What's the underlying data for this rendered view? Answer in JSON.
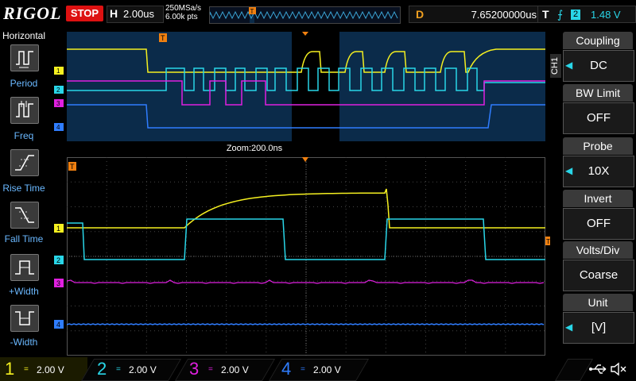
{
  "brand": "RIGOL",
  "run_state": "STOP",
  "horizontal": {
    "label": "H",
    "timebase": "2.00us",
    "sample_rate": "250MSa/s",
    "memory_depth": "6.00k pts"
  },
  "delay": {
    "label": "D",
    "value": "7.65200000us"
  },
  "trigger": {
    "label": "T",
    "source": "2",
    "level": "1.48 V",
    "marker": "T"
  },
  "sidebar": {
    "title": "Horizontal",
    "items": [
      {
        "label": "Period"
      },
      {
        "label": "Freq"
      },
      {
        "label": "Rise Time"
      },
      {
        "label": "Fall Time"
      },
      {
        "label": "+Width"
      },
      {
        "label": "-Width"
      }
    ]
  },
  "zoom_label": "Zoom:200.0ns",
  "right_menu": {
    "channel_tag": "CH1",
    "items": [
      {
        "title": "Coupling",
        "value": "DC"
      },
      {
        "title": "BW Limit",
        "value": "OFF"
      },
      {
        "title": "Probe",
        "value": "10X"
      },
      {
        "title": "Invert",
        "value": "OFF"
      },
      {
        "title": "Volts/Div",
        "value": "Coarse"
      },
      {
        "title": "Unit",
        "value": "[V]"
      }
    ]
  },
  "channels": [
    {
      "number": "1",
      "coupling": "=",
      "scale": "2.00 V",
      "color": "#f5f020"
    },
    {
      "number": "2",
      "coupling": "=",
      "scale": "2.00 V",
      "color": "#29d6e8"
    },
    {
      "number": "3",
      "coupling": "=",
      "scale": "2.00 V",
      "color": "#e020e0"
    },
    {
      "number": "4",
      "coupling": "=",
      "scale": "2.00 V",
      "color": "#2f7dff"
    }
  ],
  "colors": {
    "ch1": "#f5f020",
    "ch2": "#29d6e8",
    "ch3": "#e020e0",
    "ch4": "#2f7dff",
    "trigger": "#f08010"
  }
}
